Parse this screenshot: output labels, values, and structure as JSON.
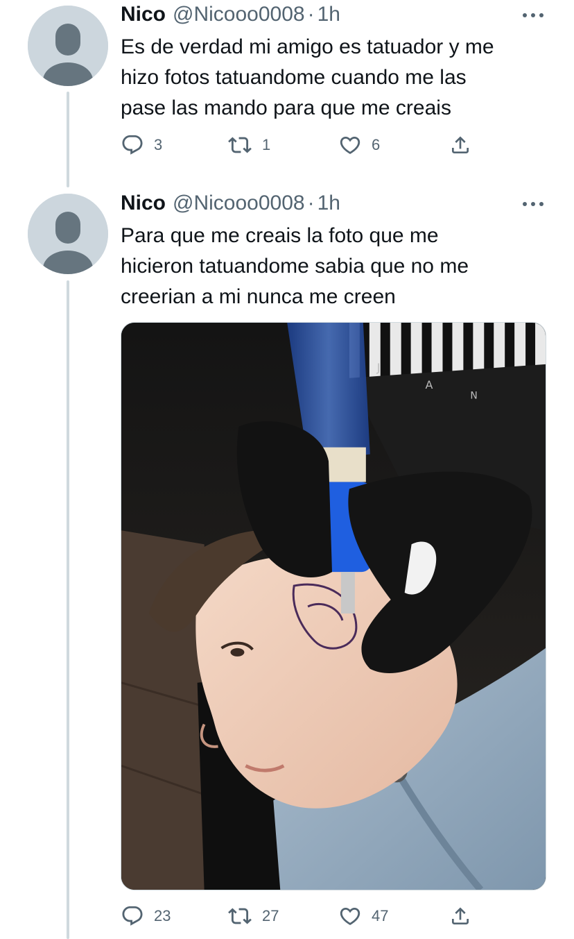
{
  "tweets": [
    {
      "display_name": "Nico",
      "handle": "@Nicooo0008",
      "separator": "·",
      "time": "1h",
      "text_lines": [
        "Es de verdad mi amigo es tatuador y me",
        "hizo fotos tatuandome cuando me las",
        "pase las mando para que me creais"
      ],
      "replies": "3",
      "retweets": "1",
      "likes": "6"
    },
    {
      "display_name": "Nico",
      "handle": "@Nicooo0008",
      "separator": "·",
      "time": "1h",
      "text_lines": [
        "Para que me creais la foto que me",
        "hicieron tatuandome sabia que no me",
        "creerian a mi nunca me creen"
      ],
      "replies": "23",
      "retweets": "27",
      "likes": "47"
    }
  ],
  "colors": {
    "text_primary": "#0f1419",
    "text_secondary": "#536471",
    "thread_line": "#cfd9de",
    "avatar_bg": "#ccd6dd",
    "avatar_fg": "#66757f"
  },
  "icons": {
    "reply": "reply-icon",
    "retweet": "retweet-icon",
    "like": "like-icon",
    "share": "share-icon",
    "more": "more-icon"
  }
}
